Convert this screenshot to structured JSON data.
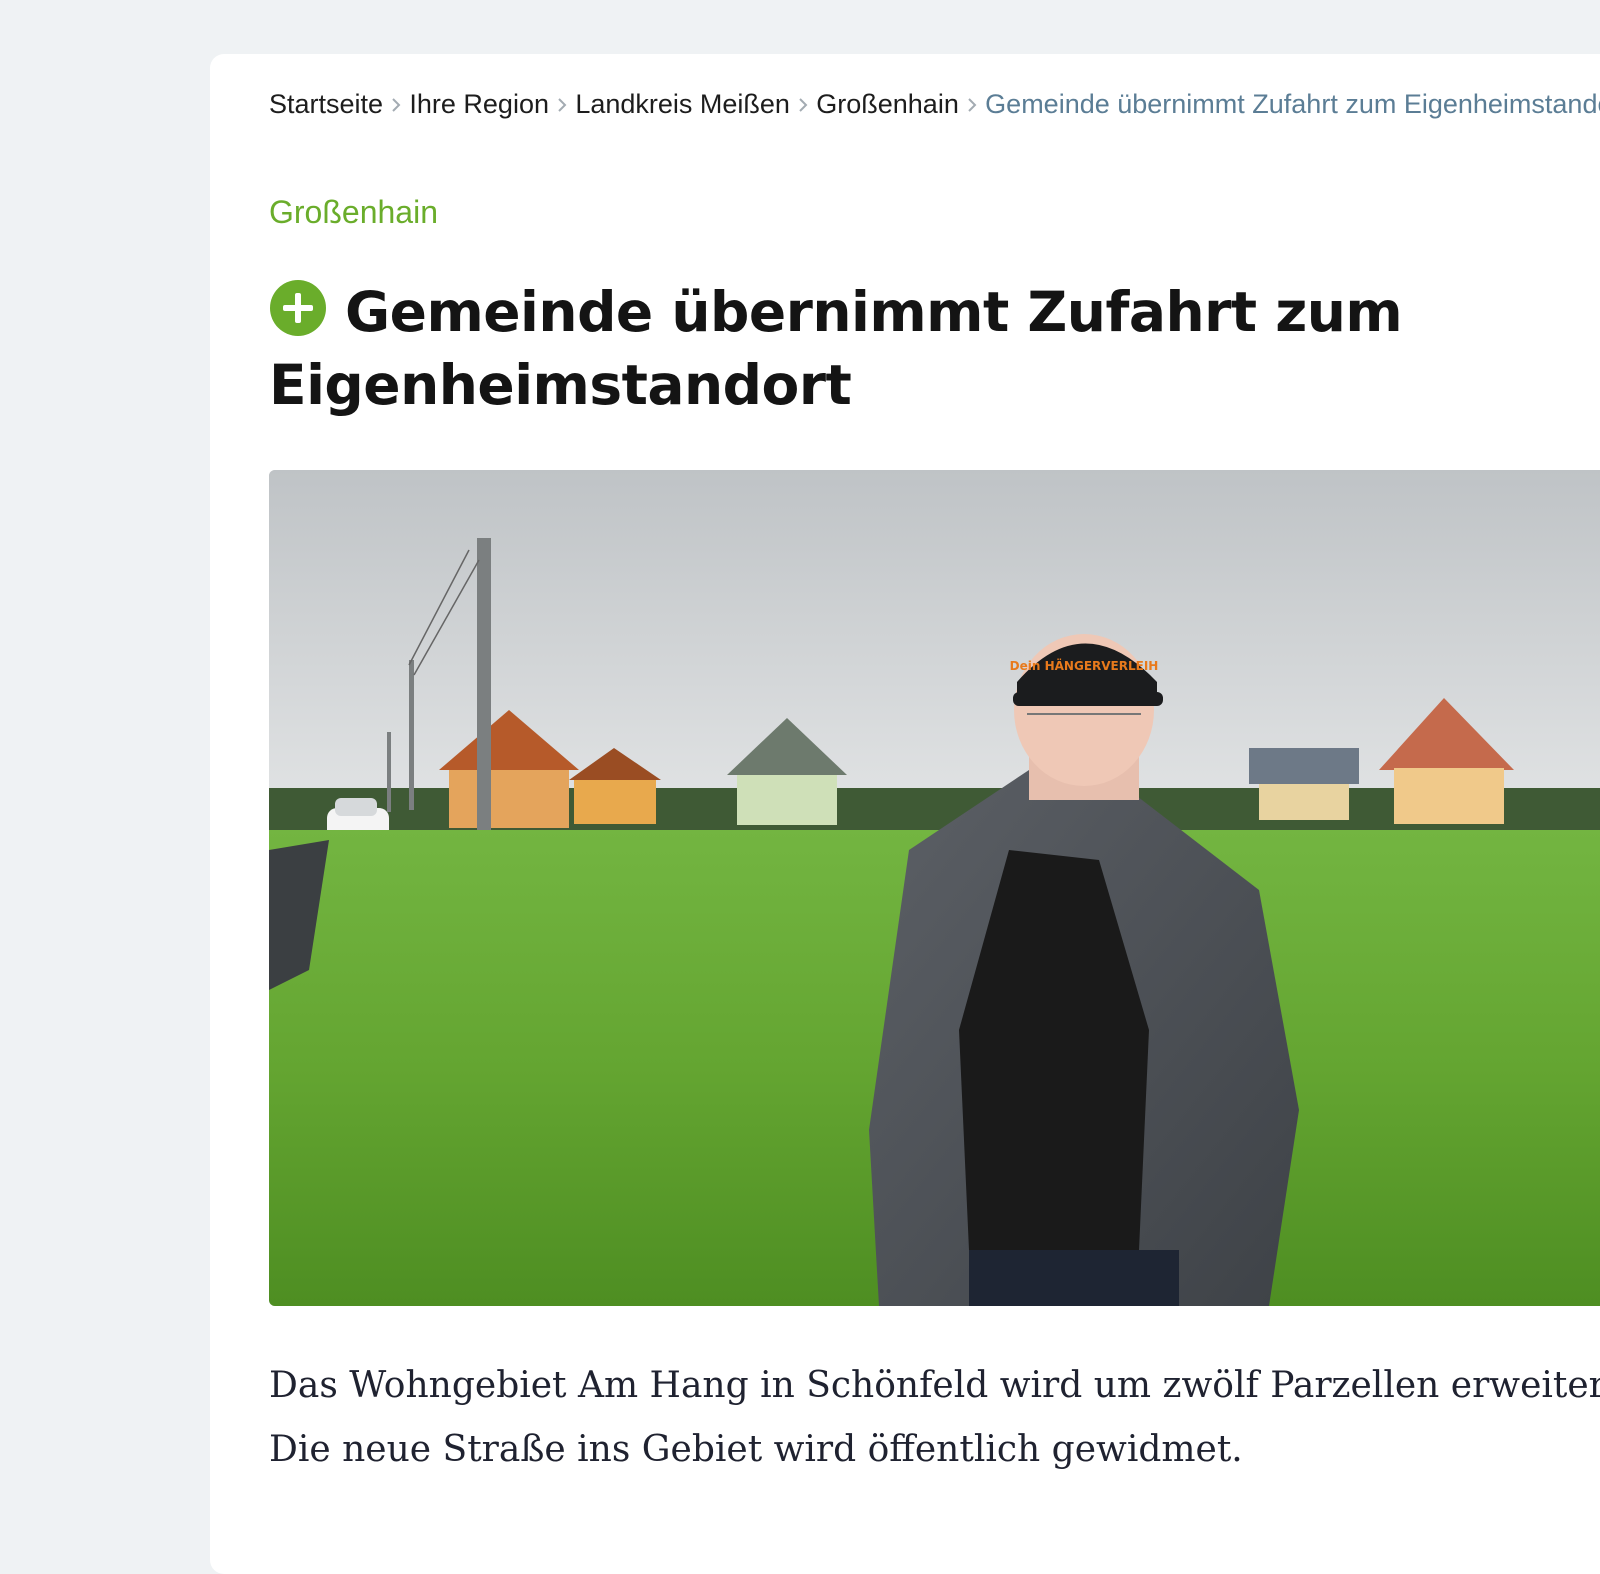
{
  "breadcrumb": {
    "items": [
      {
        "label": "Startseite"
      },
      {
        "label": "Ihre Region"
      },
      {
        "label": "Landkreis Meißen"
      },
      {
        "label": "Großenhain"
      }
    ],
    "current": "Gemeinde übernimmt Zufahrt zum Eigenheimstandort"
  },
  "article": {
    "kicker": "Großenhain",
    "premium_icon": "plus-circle-icon",
    "headline": "Gemeinde übernimmt Zufahrt zum Eigenheimstandort",
    "teaser_line1": "Das Wohngebiet Am Hang in Schönfeld wird um zwölf Parzellen erweitert.",
    "teaser_line2": "Die neue Straße ins Gebiet wird öffentlich gewidmet.",
    "cap_text": "Dein HÄNGERVERLEIH"
  },
  "colors": {
    "accent_green": "#6aad2b",
    "breadcrumb_current": "#5b7d95",
    "page_background": "#eff2f4"
  }
}
